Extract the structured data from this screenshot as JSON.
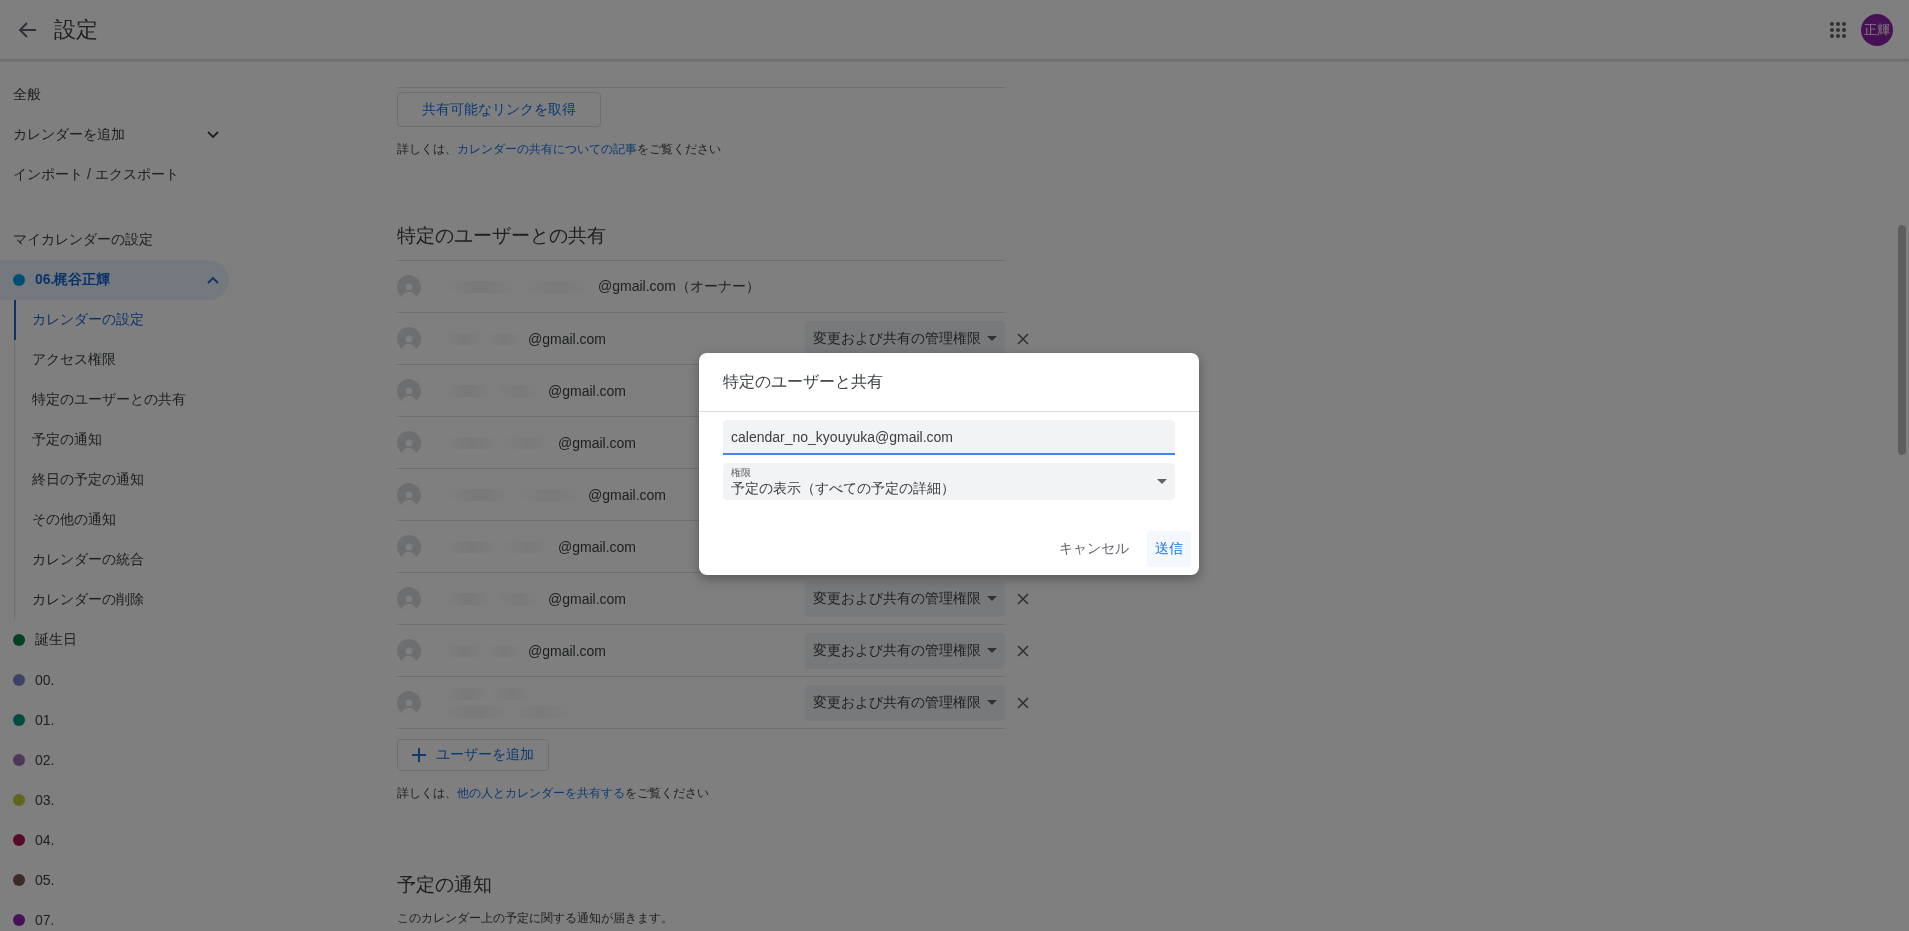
{
  "header": {
    "title": "設定",
    "avatar": "正輝"
  },
  "sidebar": {
    "top_items": [
      {
        "label": "全般",
        "kind": "link"
      },
      {
        "label": "カレンダーを追加",
        "kind": "expand"
      },
      {
        "label": "インポート / エクスポート",
        "kind": "link"
      }
    ],
    "section_title": "マイカレンダーの設定",
    "calendars": [
      {
        "name": "06.梶谷正輝",
        "color": "#014e72",
        "selected": true,
        "expanded": true,
        "children": [
          {
            "label": "カレンダーの設定",
            "selected": true
          },
          {
            "label": "アクセス権限",
            "selected": false
          },
          {
            "label": "特定のユーザーとの共有",
            "selected": false
          },
          {
            "label": "予定の通知",
            "selected": false
          },
          {
            "label": "終日の予定の通知",
            "selected": false
          },
          {
            "label": "その他の通知",
            "selected": false
          },
          {
            "label": "カレンダーの統合",
            "selected": false
          },
          {
            "label": "カレンダーの削除",
            "selected": false
          }
        ]
      },
      {
        "name": "誕生日",
        "color": "#054021",
        "selected": false
      },
      {
        "name": "00.",
        "color": "#3c4365",
        "selected": false
      },
      {
        "name": "01.",
        "color": "#004b44",
        "selected": false
      },
      {
        "name": "02.",
        "color": "#503658",
        "selected": false
      },
      {
        "name": "03.",
        "color": "#606519",
        "selected": false
      },
      {
        "name": "04.",
        "color": "#560a2b",
        "selected": false
      },
      {
        "name": "05.",
        "color": "#3c2a24",
        "selected": false
      },
      {
        "name": "07.",
        "color": "#471255",
        "selected": false
      }
    ]
  },
  "content": {
    "link_button": "共有可能なリンクを取得",
    "help_1": {
      "before": "詳しくは、",
      "link": "カレンダーの共有についての記事",
      "after": "をご覧ください"
    },
    "sharing": {
      "title": "特定のユーザーとの共有",
      "rows": [
        {
          "kind": "email",
          "email": "@gmail.com（オーナー）"
        },
        {
          "kind": "email",
          "email": "@gmail.com",
          "role": "変更および共有の管理権限"
        },
        {
          "kind": "email",
          "email": "@gmail.com"
        },
        {
          "kind": "email",
          "email": "@gmail.com"
        },
        {
          "kind": "email",
          "email": "@gmail.com"
        },
        {
          "kind": "email",
          "email": "@gmail.com"
        },
        {
          "kind": "email",
          "email": "@gmail.com",
          "role": "変更および共有の管理権限"
        },
        {
          "kind": "email",
          "email": "@gmail.com",
          "role": "変更および共有の管理権限"
        },
        {
          "kind": "redacted",
          "role": "変更および共有の管理権限"
        }
      ],
      "add_user_button": "ユーザーを追加",
      "help_2": {
        "before": "詳しくは、",
        "link": "他の人とカレンダーを共有する",
        "after": "をご覧ください"
      }
    },
    "notifications": {
      "title": "予定の通知",
      "description": "このカレンダー上の予定に関する通知が届きます。"
    }
  },
  "dialog": {
    "title": "特定のユーザーと共有",
    "email_value": "calendar_no_kyouyuka@gmail.com",
    "permission_label": "権限",
    "permission_value": "予定の表示（すべての予定の詳細）",
    "cancel": "キャンセル",
    "submit": "送信"
  }
}
